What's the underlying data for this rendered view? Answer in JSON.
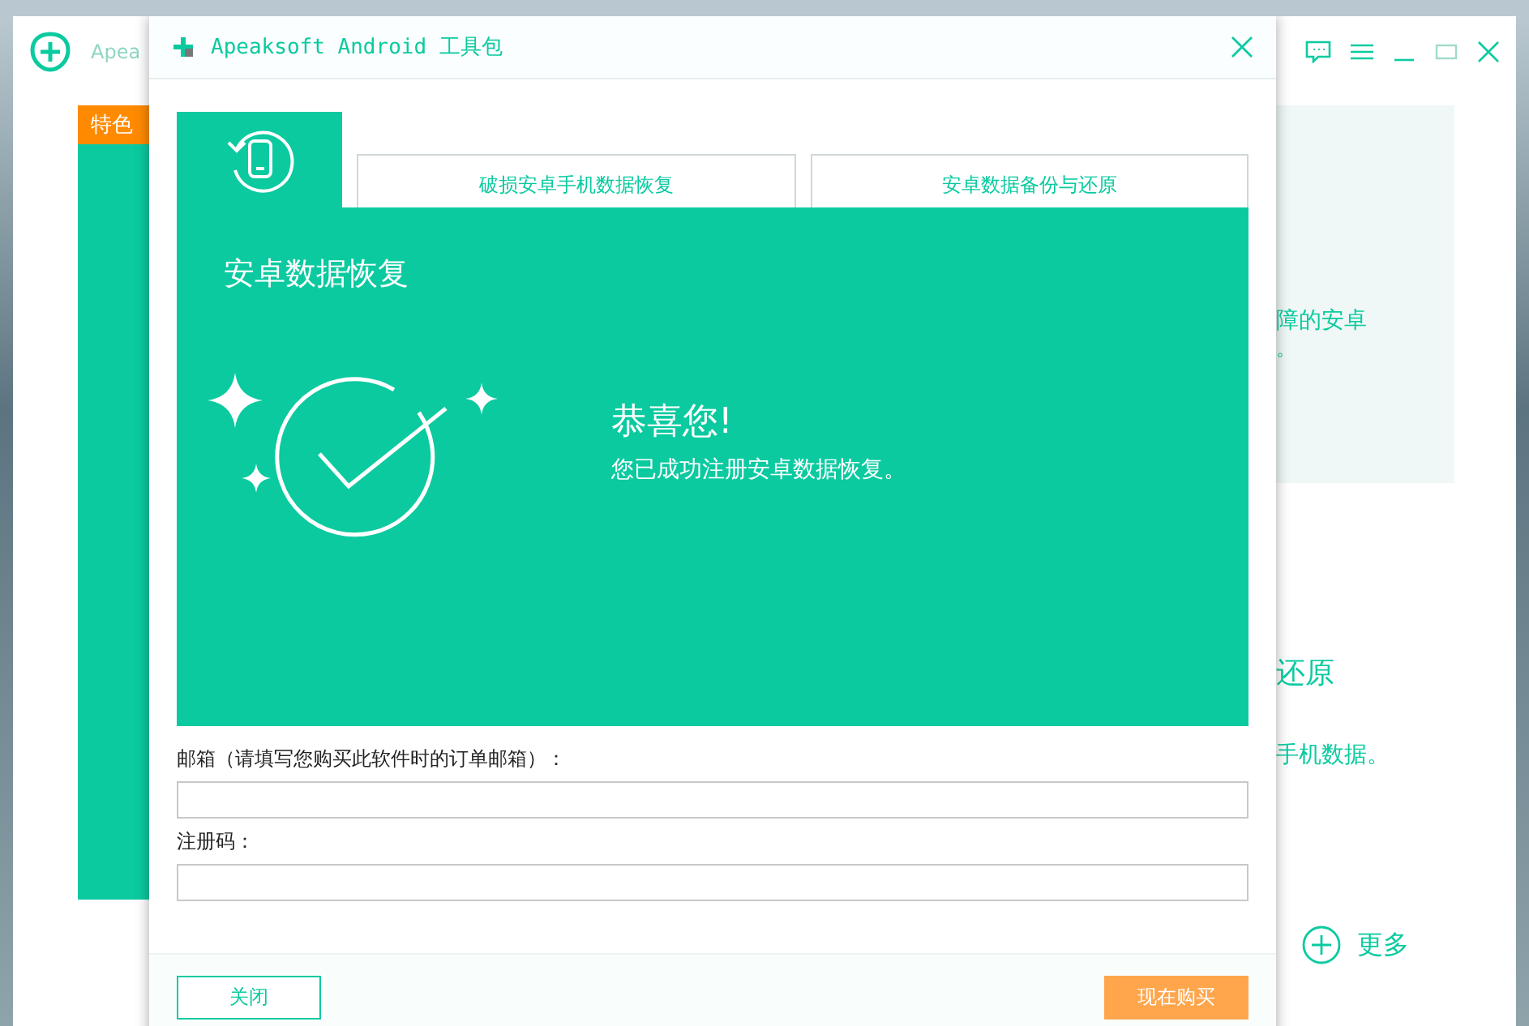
{
  "app": {
    "title": "Apea",
    "badge": "特色",
    "right_texts": [
      "障的安卓",
      "。",
      "还原",
      "手机数据。"
    ],
    "more": "更多"
  },
  "dialog": {
    "title": "Apeaksoft Android 工具包",
    "tabs": [
      {
        "kind": "icon",
        "selected": true
      },
      {
        "kind": "text",
        "label": "破损安卓手机数据恢复",
        "selected": false
      },
      {
        "kind": "text",
        "label": "安卓数据备份与还原",
        "selected": false
      }
    ],
    "panel_title": "安卓数据恢复",
    "headline": "恭喜您!",
    "message": "您已成功注册安卓数据恢复。",
    "fields": [
      {
        "label": "邮箱（请填写您购买此软件时的订单邮箱）："
      },
      {
        "label": "注册码："
      }
    ],
    "buttons": [
      {
        "kind": "secondary",
        "label": "关闭"
      },
      {
        "kind": "primary",
        "label": "现在购买"
      }
    ]
  }
}
